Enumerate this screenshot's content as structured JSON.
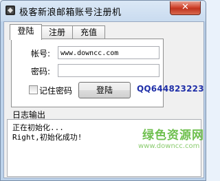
{
  "window": {
    "title": "极客新浪邮箱账号注册机",
    "close_label": "✕"
  },
  "tabs": [
    {
      "label": "登陆",
      "active": true
    },
    {
      "label": "注册",
      "active": false
    },
    {
      "label": "充值",
      "active": false
    }
  ],
  "login": {
    "account_label": "帐号:",
    "account_value": "www.downcc.com",
    "password_label": "密码:",
    "password_value": "",
    "remember_label": "记住密码",
    "remember_checked": false,
    "login_button": "登陆",
    "qq_text": "QQ644823223"
  },
  "log": {
    "group_label": "日志输出",
    "lines": [
      "正在初始化...",
      "Right,初始化成功!"
    ]
  },
  "watermark": {
    "logo_text": "绿色资源网",
    "url_text": "www.downcc.com"
  },
  "colors": {
    "qq_text": "#1f2fa8",
    "watermark": "#6fc04f",
    "close_button": "#c9402a"
  }
}
